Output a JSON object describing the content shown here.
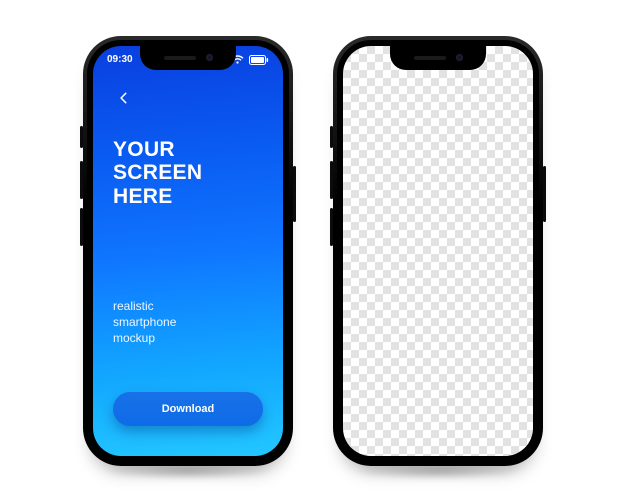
{
  "status": {
    "time": "09:30"
  },
  "hero": {
    "headline_line1": "YOUR",
    "headline_line2": "SCREEN",
    "headline_line3": "HERE",
    "subtitle_line1": "realistic",
    "subtitle_line2": "smartphone",
    "subtitle_line3": "mockup"
  },
  "cta": {
    "label": "Download"
  },
  "colors": {
    "blue_top": "#0a3fe0",
    "blue_bottom": "#23c7ff",
    "button": "#0a68e6"
  }
}
